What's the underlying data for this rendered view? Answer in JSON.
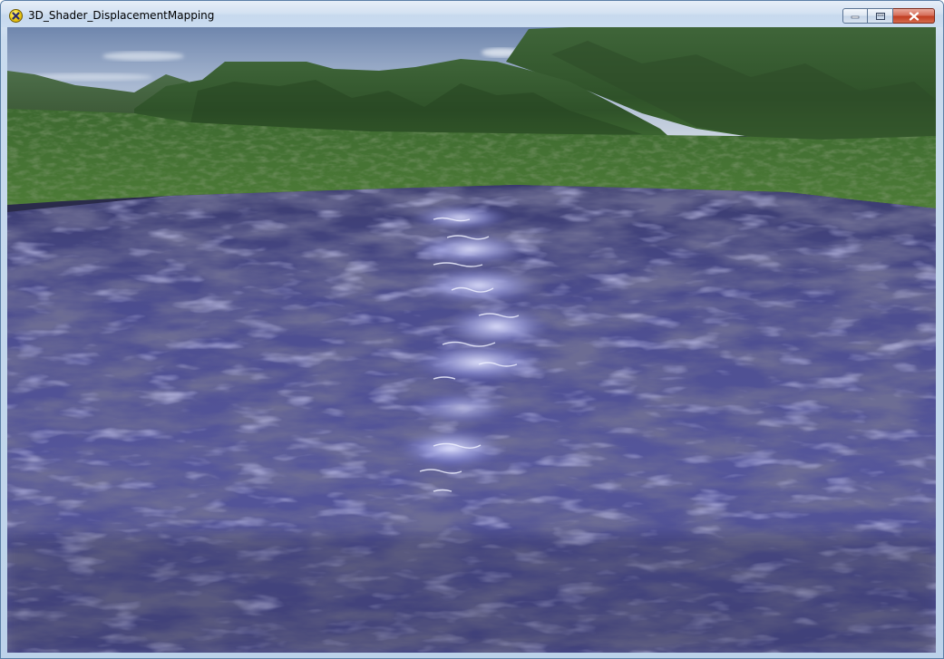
{
  "window": {
    "title": "3D_Shader_DisplacementMapping",
    "buttons": {
      "minimize": "minimize-icon",
      "maximize": "maximize-icon",
      "close": "close-icon"
    }
  },
  "scene": {
    "sky_color": "#8fa6c6",
    "mountain_color": "#3f6b35",
    "water_color": "#5d5ea8",
    "specular_color": "#d8dcff"
  }
}
